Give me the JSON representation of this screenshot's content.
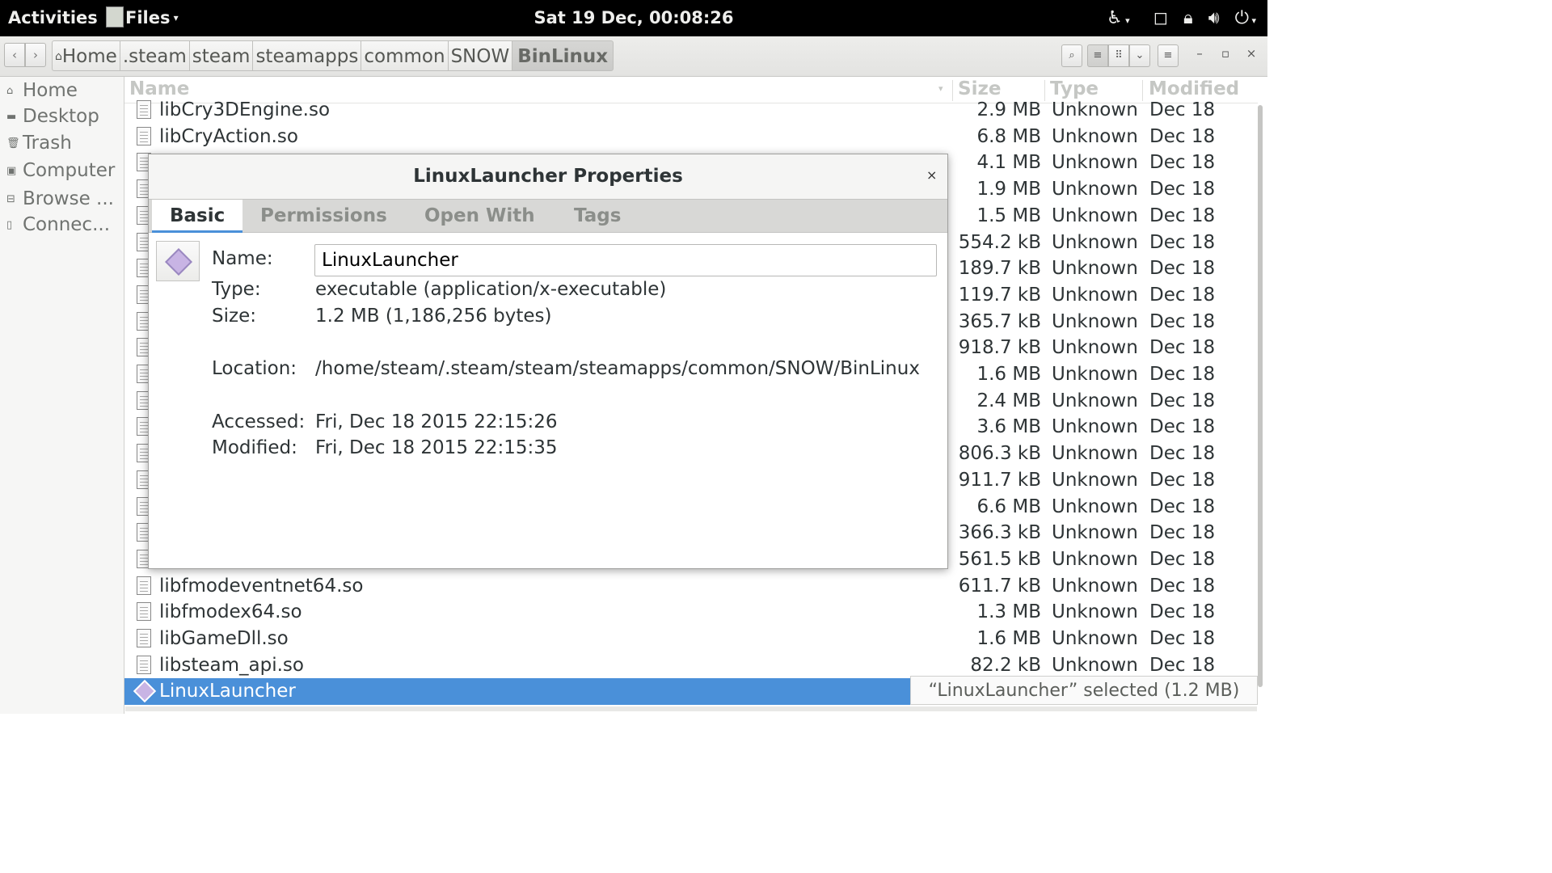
{
  "topbar": {
    "activities": "Activities",
    "app_menu": "Files",
    "clock": "Sat 19 Dec, 00:08:26",
    "icons": [
      "accessibility-icon",
      "chevron-down-icon",
      "window-icon",
      "lock-icon",
      "volume-icon",
      "power-icon",
      "chevron-down-icon"
    ]
  },
  "toolbar": {
    "back": "‹",
    "forward": "›",
    "breadcrumbs": [
      "Home",
      ".steam",
      "steam",
      "steamapps",
      "common",
      "SNOW",
      "BinLinux"
    ],
    "search": "⌕",
    "list_view": "≡",
    "grid_view": "⠿",
    "view_options": "⌄",
    "menu": "≡",
    "minimize": "–",
    "maximize": "▫",
    "close": "×"
  },
  "sidebar": {
    "items": [
      {
        "label": "Home",
        "icon": "home-icon"
      },
      {
        "label": "Desktop",
        "icon": "folder-icon"
      },
      {
        "label": "Trash",
        "icon": "trash-icon"
      },
      {
        "label": "Computer",
        "icon": "drive-icon"
      },
      {
        "label": "Browse ...",
        "icon": "network-icon"
      },
      {
        "label": "Connec...",
        "icon": "server-icon"
      }
    ]
  },
  "columns": {
    "name": "Name",
    "size": "Size",
    "type": "Type",
    "modified": "Modified"
  },
  "files": [
    {
      "name": "libCry3DEngine.so",
      "size": "2.9 MB",
      "type": "Unknown",
      "modified": "Dec 18"
    },
    {
      "name": "libCryAction.so",
      "size": "6.8 MB",
      "type": "Unknown",
      "modified": "Dec 18"
    },
    {
      "name": "",
      "size": "4.1 MB",
      "type": "Unknown",
      "modified": "Dec 18"
    },
    {
      "name": "",
      "size": "1.9 MB",
      "type": "Unknown",
      "modified": "Dec 18"
    },
    {
      "name": "",
      "size": "1.5 MB",
      "type": "Unknown",
      "modified": "Dec 18"
    },
    {
      "name": "",
      "size": "554.2 kB",
      "type": "Unknown",
      "modified": "Dec 18"
    },
    {
      "name": "",
      "size": "189.7 kB",
      "type": "Unknown",
      "modified": "Dec 18"
    },
    {
      "name": "",
      "size": "119.7 kB",
      "type": "Unknown",
      "modified": "Dec 18"
    },
    {
      "name": "",
      "size": "365.7 kB",
      "type": "Unknown",
      "modified": "Dec 18"
    },
    {
      "name": "",
      "size": "918.7 kB",
      "type": "Unknown",
      "modified": "Dec 18"
    },
    {
      "name": "",
      "size": "1.6 MB",
      "type": "Unknown",
      "modified": "Dec 18"
    },
    {
      "name": "",
      "size": "2.4 MB",
      "type": "Unknown",
      "modified": "Dec 18"
    },
    {
      "name": "",
      "size": "3.6 MB",
      "type": "Unknown",
      "modified": "Dec 18"
    },
    {
      "name": "",
      "size": "806.3 kB",
      "type": "Unknown",
      "modified": "Dec 18"
    },
    {
      "name": "",
      "size": "911.7 kB",
      "type": "Unknown",
      "modified": "Dec 18"
    },
    {
      "name": "",
      "size": "6.6 MB",
      "type": "Unknown",
      "modified": "Dec 18"
    },
    {
      "name": "",
      "size": "366.3 kB",
      "type": "Unknown",
      "modified": "Dec 18"
    },
    {
      "name": "",
      "size": "561.5 kB",
      "type": "Unknown",
      "modified": "Dec 18"
    },
    {
      "name": "libfmodeventnet64.so",
      "size": "611.7 kB",
      "type": "Unknown",
      "modified": "Dec 18"
    },
    {
      "name": "libfmodex64.so",
      "size": "1.3 MB",
      "type": "Unknown",
      "modified": "Dec 18"
    },
    {
      "name": "libGameDll.so",
      "size": "1.6 MB",
      "type": "Unknown",
      "modified": "Dec 18"
    },
    {
      "name": "libsteam_api.so",
      "size": "82.2 kB",
      "type": "Unknown",
      "modified": "Dec 18"
    }
  ],
  "selected_file": {
    "name": "LinuxLauncher"
  },
  "status": "“LinuxLauncher” selected (1.2 MB)",
  "dialog": {
    "title": "LinuxLauncher Properties",
    "close": "×",
    "tabs": [
      "Basic",
      "Permissions",
      "Open With",
      "Tags"
    ],
    "labels": {
      "name": "Name:",
      "type": "Type:",
      "size": "Size:",
      "location": "Location:",
      "accessed": "Accessed:",
      "modified": "Modified:"
    },
    "values": {
      "name": "LinuxLauncher",
      "type": "executable (application/x-executable)",
      "size": "1.2 MB (1,186,256 bytes)",
      "location": "/home/steam/.steam/steam/steamapps/common/SNOW/BinLinux",
      "accessed": "Fri, Dec 18 2015 22:15:26",
      "modified": "Fri, Dec 18 2015 22:15:35"
    }
  }
}
